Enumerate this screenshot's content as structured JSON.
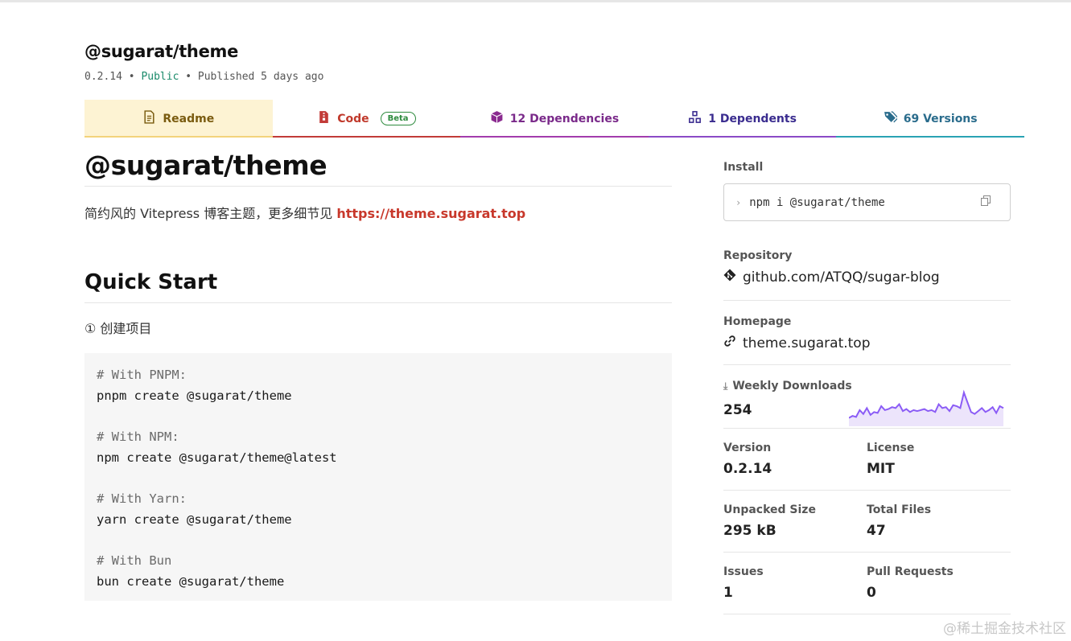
{
  "package": {
    "name": "@sugarat/theme",
    "version_meta": "0.2.14",
    "visibility": "Public",
    "published": "Published 5 days ago",
    "separator": "•"
  },
  "tabs": [
    {
      "label": "Readme",
      "icon": "file-text-icon"
    },
    {
      "label": "Code",
      "icon": "file-zip-icon",
      "badge": "Beta"
    },
    {
      "label": "12 Dependencies",
      "icon": "box-icon"
    },
    {
      "label": "1 Dependents",
      "icon": "boxes-icon"
    },
    {
      "label": "69 Versions",
      "icon": "tags-icon"
    }
  ],
  "readme": {
    "title": "@sugarat/theme",
    "intro_text": "简约风的 Vitepress 博客主题，更多细节见 ",
    "intro_link": "https://theme.sugarat.top",
    "section_title": "Quick Start",
    "step": "① 创建项目",
    "code": [
      {
        "comment": "# With PNPM:",
        "cmd": "pnpm create @sugarat/theme"
      },
      {
        "comment": "# With NPM:",
        "cmd": "npm create @sugarat/theme@latest"
      },
      {
        "comment": "# With Yarn:",
        "cmd": "yarn create @sugarat/theme"
      },
      {
        "comment": "# With Bun",
        "cmd": "bun create @sugarat/theme"
      }
    ]
  },
  "sidebar": {
    "install_label": "Install",
    "install_cmd": "npm i @sugarat/theme",
    "repository_label": "Repository",
    "repository": "github.com/ATQQ/sugar-blog",
    "homepage_label": "Homepage",
    "homepage": "theme.sugarat.top",
    "downloads_label": "Weekly Downloads",
    "downloads": "254",
    "downloads_trend": [
      2,
      4,
      3,
      10,
      6,
      12,
      5,
      8,
      7,
      14,
      10,
      11,
      13,
      12,
      16,
      9,
      11,
      8,
      10,
      9,
      10,
      11,
      9,
      10,
      8,
      16,
      12,
      13,
      9,
      15,
      14,
      12,
      28,
      18,
      8,
      6,
      9,
      12,
      8,
      10,
      13,
      7,
      14,
      12
    ],
    "stats": [
      {
        "label": "Version",
        "value": "0.2.14"
      },
      {
        "label": "License",
        "value": "MIT"
      },
      {
        "label": "Unpacked Size",
        "value": "295 kB"
      },
      {
        "label": "Total Files",
        "value": "47"
      },
      {
        "label": "Issues",
        "value": "1"
      },
      {
        "label": "Pull Requests",
        "value": "0"
      }
    ]
  },
  "watermark": "@稀土掘金技术社区",
  "colors": {
    "readme_tab_bg": "#fdf3d3",
    "link_red": "#c8382b",
    "spark_line": "#8b5cf6",
    "spark_fill": "#ece4fb"
  }
}
